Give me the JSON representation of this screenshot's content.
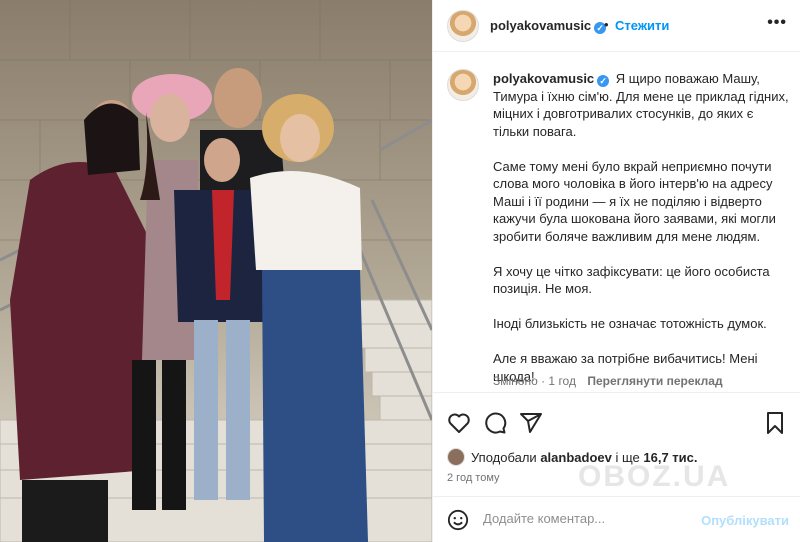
{
  "post": {
    "username": "polyakovamusic",
    "follow_label": "Стежити",
    "separator": "•",
    "more_label": "•••"
  },
  "caption": {
    "username": "polyakovamusic",
    "paragraphs": [
      "Я щиро поважаю Машу, Тимура і їхню сім'ю. Для мене це приклад гідних, міцних і довготривалих стосунків, до яких є тільки повага.",
      "Саме тому мені було вкрай неприємно почути слова мого чоловіка в його інтерв'ю на адресу Маші і її родини — я їх не поділяю і відверто кажучи була шокована його заявами, які могли зробити боляче важливим для мене людям.",
      "Я хочу це чітко зафіксувати: це його особиста позиція. Не моя.",
      "Іноді близькість не означає тотожність думок.",
      "Але я вважаю за потрібне вибачитись! Мені шкода!"
    ],
    "edited": "Змінено · 1 год",
    "translate": "Переглянути переклад"
  },
  "likes": {
    "prefix": "Уподобали",
    "user": "alanbadoev",
    "middle": "і ще",
    "count": "16,7 тис."
  },
  "time": "2 год тому",
  "comment": {
    "placeholder": "Додайте коментар...",
    "post_label": "Опублікувати"
  },
  "watermark": "OBOZ.UA",
  "icons": {
    "verified": "verified-badge-icon",
    "like": "heart-icon",
    "comment": "comment-icon",
    "share": "share-icon",
    "save": "bookmark-icon",
    "emoji": "emoji-icon"
  },
  "colors": {
    "accent": "#0095f6",
    "text": "#262626",
    "muted": "#737373"
  }
}
